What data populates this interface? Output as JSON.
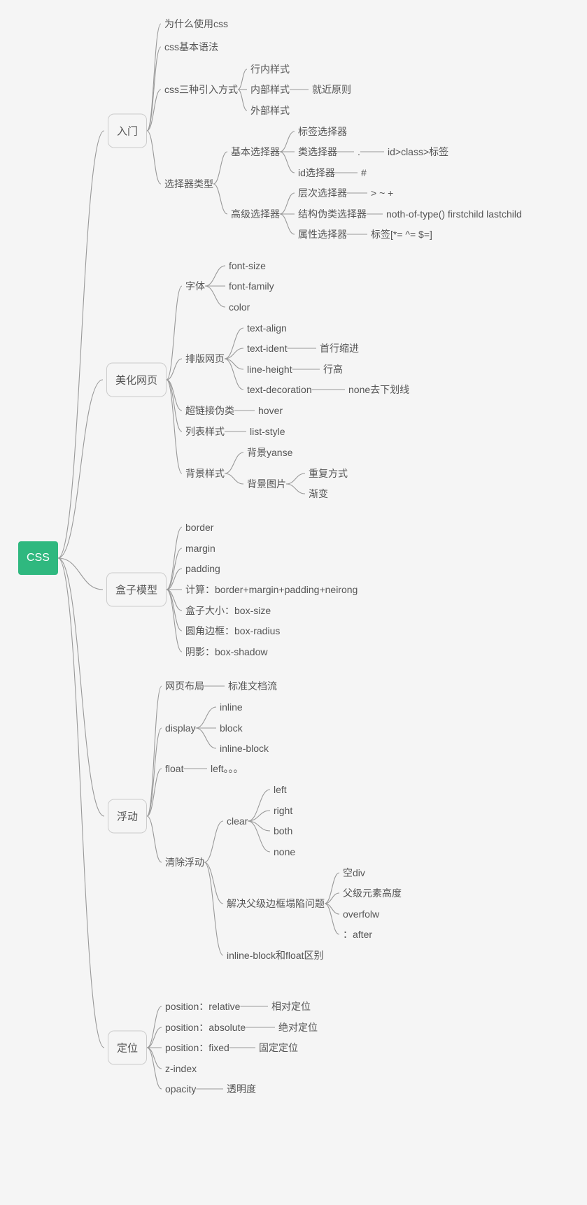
{
  "root": "CSS",
  "l1": {
    "n0": "入门",
    "n1": "美化网页",
    "n2": "盒子模型",
    "n3": "浮动",
    "n4": "定位"
  },
  "intro": {
    "a": "为什么使用css",
    "b": "css基本语法",
    "c": "css三种引入方式",
    "c1": "行内样式",
    "c2": "内部样式",
    "c2n": "就近原则",
    "c3": "外部样式",
    "d": "选择器类型",
    "d1": "基本选择器",
    "d1a": "标签选择器",
    "d1b": "类选择器",
    "d1b_n1": ".",
    "d1b_n2": "id>class>标签",
    "d1c": "id选择器",
    "d1c_n": "#",
    "d2": "高级选择器",
    "d2a": "层次选择器",
    "d2a_n": "> ~ +",
    "d2b": "结构伪类选择器",
    "d2b_n": "noth-of-type() firstchild lastchild",
    "d2c": "属性选择器",
    "d2c_n": "标签[*= ^= $=]"
  },
  "beauty": {
    "font": "字体",
    "f1": "font-size",
    "f2": "font-family",
    "f3": "color",
    "typeset": "排版网页",
    "t1": "text-align",
    "t2": "text-ident",
    "t2n": "首行缩进",
    "t3": "line-height",
    "t3n": "行高",
    "t4": "text-decoration",
    "t4n": "none去下划线",
    "link": "超链接伪类",
    "link_n": "hover",
    "list": "列表样式",
    "list_n": "list-style",
    "bg": "背景样式",
    "bg1": "背景yanse",
    "bg2": "背景图片",
    "bg2a": "重复方式",
    "bg2b": "渐变"
  },
  "box": {
    "b1": "border",
    "b2": "margin",
    "b3": "padding",
    "b4": "计算：border+margin+padding+neirong",
    "b5": "盒子大小：box-size",
    "b6": "圆角边框：box-radius",
    "b7": "阴影：box-shadow"
  },
  "flt": {
    "a": "网页布局",
    "a_n": "标准文档流",
    "b": "display",
    "b1": "inline",
    "b2": "block",
    "b3": "inline-block",
    "c": "float",
    "c_n": "left。。。",
    "d": "清除浮动",
    "d1": "clear",
    "d1a": "left",
    "d1b": "right",
    "d1c": "both",
    "d1d": "none",
    "d2": "解决父级边框塌陷问题",
    "d2a": "空div",
    "d2b": "父级元素高度",
    "d2c": "overfolw",
    "d2d": "：after",
    "d3": "inline-block和float区别"
  },
  "pos": {
    "a": "position：relative",
    "a_n": "相对定位",
    "b": "position：absolute",
    "b_n": "绝对定位",
    "c": "position：fixed",
    "c_n": "固定定位",
    "d": "z-index",
    "e": "opacity",
    "e_n": "透明度"
  }
}
